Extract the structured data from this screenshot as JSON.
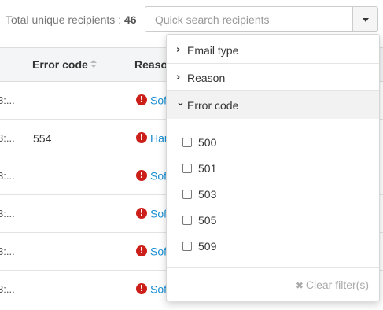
{
  "header": {
    "total_label": "Total unique recipients : ",
    "total_count": "46",
    "search_placeholder": "Quick search recipients",
    "dropdown_icon": "caret-down-icon"
  },
  "table": {
    "columns": [
      "Error code",
      "Reason"
    ],
    "rows": [
      {
        "left": "3:...",
        "code": "",
        "reason": "Sof"
      },
      {
        "left": "3:...",
        "code": "554",
        "reason": "Har"
      },
      {
        "left": "3:...",
        "code": "",
        "reason": "Sof"
      },
      {
        "left": "3:...",
        "code": "",
        "reason": "Sof"
      },
      {
        "left": "3:...",
        "code": "",
        "reason": "Sof"
      },
      {
        "left": "3:...",
        "code": "",
        "reason": "Sof"
      }
    ],
    "alert_icon": "!",
    "colors": {
      "link": "#1a8fd4",
      "alert": "#cc1f1a"
    }
  },
  "filter_panel": {
    "sections": [
      {
        "label": "Email type",
        "chevron": "›",
        "expanded": false
      },
      {
        "label": "Reason",
        "chevron": "›",
        "expanded": false
      },
      {
        "label": "Error code",
        "chevron": "⌄",
        "expanded": true
      }
    ],
    "options": [
      "500",
      "501",
      "503",
      "505",
      "509"
    ],
    "clear_icon": "✖",
    "clear_label": "Clear filter(s)"
  }
}
